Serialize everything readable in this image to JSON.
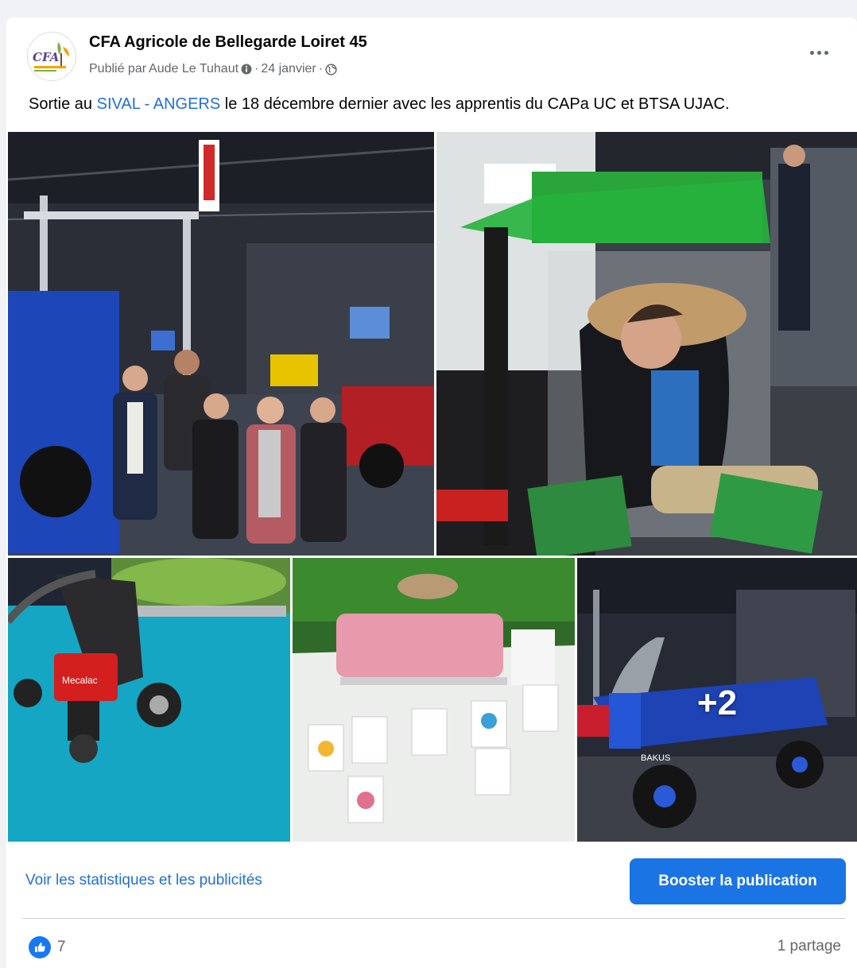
{
  "post": {
    "page_name": "CFA Agricole de Bellegarde Loiret 45",
    "published_prefix": "Publié par",
    "author": "Aude Le Tuhaut",
    "sep1": "·",
    "date": "24 janvier",
    "sep2": "·",
    "avatar_logo_text": "CFA",
    "text_before": "Sortie au ",
    "text_link": "SIVAL - ANGERS",
    "text_after": " le 18 décembre dernier avec les apprentis du CAPa UC et BTSA UJAC.",
    "link_color": "#216fdb"
  },
  "photos": {
    "extra_count": "+2",
    "icons": [
      "group-photo",
      "seat-demo-photo",
      "robot-cart-photo",
      "cards-table-photo",
      "electric-vehicle-photo"
    ],
    "vehicle_brand_text": "BAKUS",
    "robot_brand_text": "Mecalac"
  },
  "footer": {
    "stats_link": "Voir les statistiques et les publicités",
    "boost_button": "Booster la publication",
    "boost_color": "#1b74e4",
    "likes_count": "7",
    "shares": "1 partage"
  }
}
